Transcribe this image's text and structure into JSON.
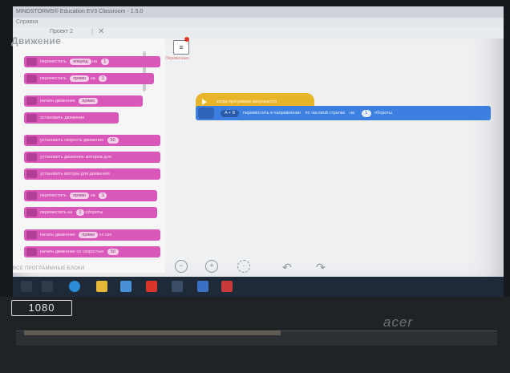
{
  "window": {
    "title": "MINDSTORMS® Education EV3 Classroom - 1.5.0",
    "menu": "Справка"
  },
  "tabs": {
    "project_label": "Проект 2"
  },
  "palette": {
    "section_title": "Движение",
    "blocks": [
      {
        "label": "переместить",
        "pill": "вперёд",
        "mid": "на",
        "num": "1"
      },
      {
        "label": "переместить",
        "pill": "прямо",
        "mid": "на",
        "num": "1"
      },
      {
        "label": "начать движение",
        "pill": "прямо"
      },
      {
        "label": "остановить движение"
      },
      {
        "label": "установить скорость движения",
        "pill": "50"
      },
      {
        "label": "установить движение моторов для"
      },
      {
        "label": "установить моторы для движения"
      },
      {
        "label": "переместить",
        "pill": "прямо",
        "mid": "на",
        "num": "1"
      },
      {
        "label": "переместить на",
        "num": "1",
        "mid": "обороты"
      },
      {
        "label": "начать движение",
        "pill": "прямо",
        "mid": "со ско"
      },
      {
        "label": "начать движение со скоростью",
        "pill": "50"
      }
    ]
  },
  "workspace": {
    "variable_label": "Переменные",
    "hat_block_label": "когда программа запускается",
    "move_block": {
      "port": "A + B",
      "text1": "переместить в направлении",
      "direction": "по часовой стрелке",
      "mid": "на",
      "num": "1",
      "unit": "обороты"
    }
  },
  "bottom": {
    "all_blocks_label": "ВСЕ ПРОГРАММНЫЕ БЛОКИ"
  },
  "laptop": {
    "hd_label": "1080",
    "brand": "acer"
  },
  "colors": {
    "motion_block": "#d957b9",
    "event_block": "#e8b52a",
    "move_block": "#3d7fe0"
  }
}
